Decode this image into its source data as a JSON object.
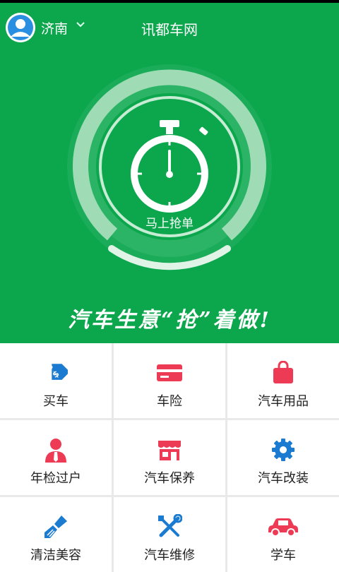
{
  "header": {
    "city": "济南",
    "title": "讯都车网"
  },
  "hero": {
    "grab_label": "马上抢单",
    "slogan": "汽车生意“抢”着做!"
  },
  "services": [
    {
      "label": "买车",
      "icon": "price-tag-icon",
      "color": "#1a7bd1"
    },
    {
      "label": "车险",
      "icon": "card-icon",
      "color": "#ee3b55"
    },
    {
      "label": "汽车用品",
      "icon": "shopping-bag-icon",
      "color": "#ee3b55"
    },
    {
      "label": "年检过户",
      "icon": "person-tie-icon",
      "color": "#ee3b55"
    },
    {
      "label": "汽车保养",
      "icon": "storefront-icon",
      "color": "#ee3b55"
    },
    {
      "label": "汽车改装",
      "icon": "gear-icon",
      "color": "#1a7bd1"
    },
    {
      "label": "清洁美容",
      "icon": "brush-icon",
      "color": "#1a7bd1"
    },
    {
      "label": "汽车维修",
      "icon": "wrench-screwdriver-icon",
      "color": "#1a7bd1"
    },
    {
      "label": "学车",
      "icon": "car-icon",
      "color": "#ee3b55"
    }
  ]
}
